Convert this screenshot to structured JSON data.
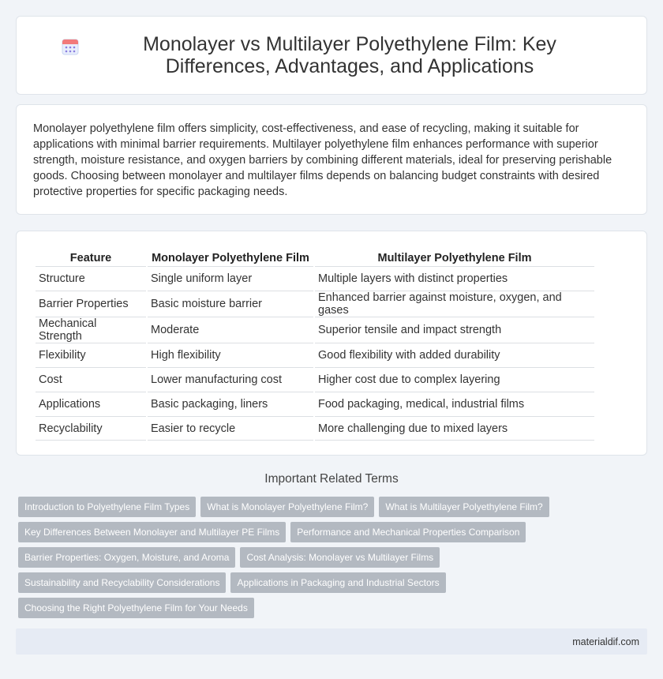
{
  "header": {
    "title": "Monolayer vs Multilayer Polyethylene Film: Key Differences, Advantages, and Applications",
    "icon": "calendar-icon"
  },
  "intro": {
    "text": "Monolayer polyethylene film offers simplicity, cost-effectiveness, and ease of recycling, making it suitable for applications with minimal barrier requirements. Multilayer polyethylene film enhances performance with superior strength, moisture resistance, and oxygen barriers by combining different materials, ideal for preserving perishable goods. Choosing between monolayer and multilayer films depends on balancing budget constraints with desired protective properties for specific packaging needs."
  },
  "table": {
    "headers": [
      "Feature",
      "Monolayer Polyethylene Film",
      "Multilayer Polyethylene Film"
    ],
    "rows": [
      [
        "Structure",
        "Single uniform layer",
        "Multiple layers with distinct properties"
      ],
      [
        "Barrier Properties",
        "Basic moisture barrier",
        "Enhanced barrier against moisture, oxygen, and gases"
      ],
      [
        "Mechanical Strength",
        "Moderate",
        "Superior tensile and impact strength"
      ],
      [
        "Flexibility",
        "High flexibility",
        "Good flexibility with added durability"
      ],
      [
        "Cost",
        "Lower manufacturing cost",
        "Higher cost due to complex layering"
      ],
      [
        "Applications",
        "Basic packaging, liners",
        "Food packaging, medical, industrial films"
      ],
      [
        "Recyclability",
        "Easier to recycle",
        "More challenging due to mixed layers"
      ]
    ]
  },
  "related": {
    "title": "Important Related Terms",
    "rows": [
      [
        "Introduction to Polyethylene Film Types",
        "What is Monolayer Polyethylene Film?",
        "What is Multilayer Polyethylene Film?"
      ],
      [
        "Key Differences Between Monolayer and Multilayer PE Films",
        "Performance and Mechanical Properties Comparison"
      ],
      [
        "Barrier Properties: Oxygen, Moisture, and Aroma",
        "Cost Analysis: Monolayer vs Multilayer Films"
      ],
      [
        "Sustainability and Recyclability Considerations",
        "Applications in Packaging and Industrial Sectors"
      ],
      [
        "Choosing the Right Polyethylene Film for Your Needs"
      ]
    ]
  },
  "footer": {
    "site": "materialdif.com"
  },
  "colors": {
    "background": "#f1f4f8",
    "tag": "#b3b9c1",
    "footer": "#e6ebf4"
  }
}
